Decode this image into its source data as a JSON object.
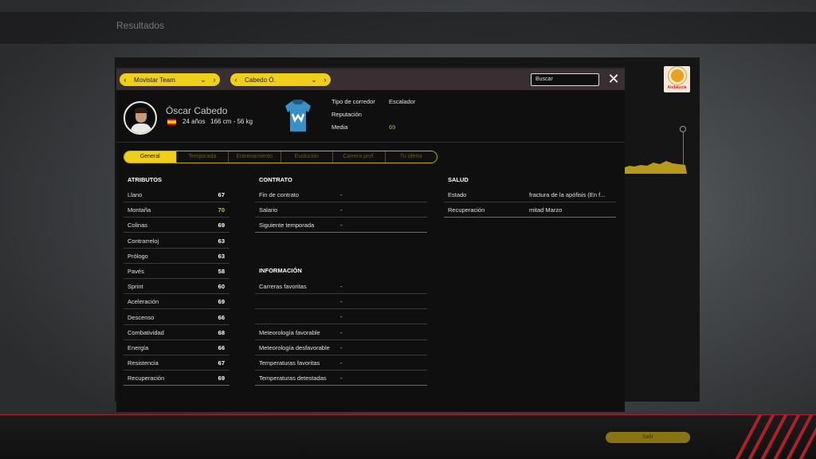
{
  "background": {
    "title": "Resultados",
    "badge_text": "Andalucía",
    "save_button": "Salir"
  },
  "header": {
    "team_selector": "Movistar Team",
    "rider_selector": "Cabedo Ó.",
    "search_placeholder": "Buscar",
    "close_icon": "close-icon"
  },
  "rider": {
    "name": "Óscar Cabedo",
    "age": "24 años",
    "height_weight": "166 cm - 56 kg",
    "type_label": "Tipo de corredor",
    "type_value": "Escalador",
    "reputation_label": "Reputación",
    "average_label": "Media",
    "average_value": "69"
  },
  "tabs": [
    "General",
    "Temporada",
    "Entrenamiento",
    "Evolución",
    "Carrera prof.",
    "Tu oferta"
  ],
  "attributes": {
    "title": "ATRIBUTOS",
    "items": [
      {
        "label": "Llano",
        "value": "67"
      },
      {
        "label": "Montaña",
        "value": "70"
      },
      {
        "label": "Colinas",
        "value": "69"
      },
      {
        "label": "Contrarreloj",
        "value": "63"
      },
      {
        "label": "Prólogo",
        "value": "63"
      },
      {
        "label": "Pavés",
        "value": "58"
      },
      {
        "label": "Sprint",
        "value": "60"
      },
      {
        "label": "Aceleración",
        "value": "69"
      },
      {
        "label": "Descenso",
        "value": "66"
      },
      {
        "label": "Combatividad",
        "value": "68"
      },
      {
        "label": "Energía",
        "value": "66"
      },
      {
        "label": "Resistencia",
        "value": "67"
      },
      {
        "label": "Recuperación",
        "value": "69"
      }
    ]
  },
  "contract": {
    "title": "CONTRATO",
    "items": [
      {
        "label": "Fin de contrato",
        "value": "-"
      },
      {
        "label": "Salario",
        "value": "-"
      },
      {
        "label": "Siguiente temporada",
        "value": "-"
      }
    ]
  },
  "information": {
    "title": "INFORMACIÓN",
    "items": [
      {
        "label": "Carreras favoritas",
        "value": "-"
      },
      {
        "label": "",
        "value": "-"
      },
      {
        "label": "",
        "value": "-"
      },
      {
        "label": "Meteorología favorable",
        "value": "-"
      },
      {
        "label": "Meteorología desfavorable",
        "value": "-"
      },
      {
        "label": "Temperaturas favoritas",
        "value": "-"
      },
      {
        "label": "Temperaturas detestadas",
        "value": "-"
      }
    ]
  },
  "health": {
    "title": "SALUD",
    "items": [
      {
        "label": "Estado",
        "value": "fractura de la apófisis (En f..."
      },
      {
        "label": "Recuperación",
        "value": "mitad Marzo"
      }
    ]
  },
  "colors": {
    "accent": "#f0cf1a",
    "highlight_value": "#a8d23a",
    "header_bg": "#3a2f30"
  }
}
